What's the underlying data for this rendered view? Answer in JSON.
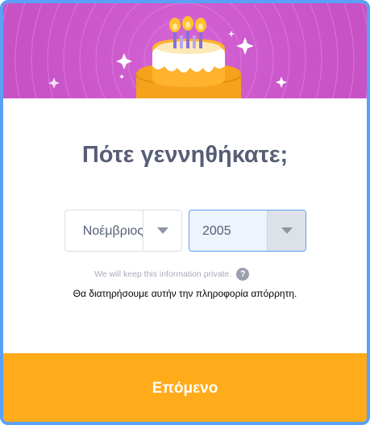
{
  "title": "Πότε γεννηθήκατε;",
  "month_select": {
    "value": "Νοέμβριος",
    "arrow_icon": "chevron-down-icon"
  },
  "year_select": {
    "value": "2005",
    "arrow_icon": "chevron-down-icon"
  },
  "privacy_note": "We will keep this information private.",
  "privacy_help_icon": "question-icon",
  "privacy_note_translation": "Θα διατηρήσουμε αυτήν την πληροφορία απόρρητη.",
  "next_button_label": "Επόμενο",
  "colors": {
    "banner": "#cf5ccf",
    "accent_border": "#5aa0f5",
    "title": "#575e75",
    "next_button": "#ffab1a"
  }
}
